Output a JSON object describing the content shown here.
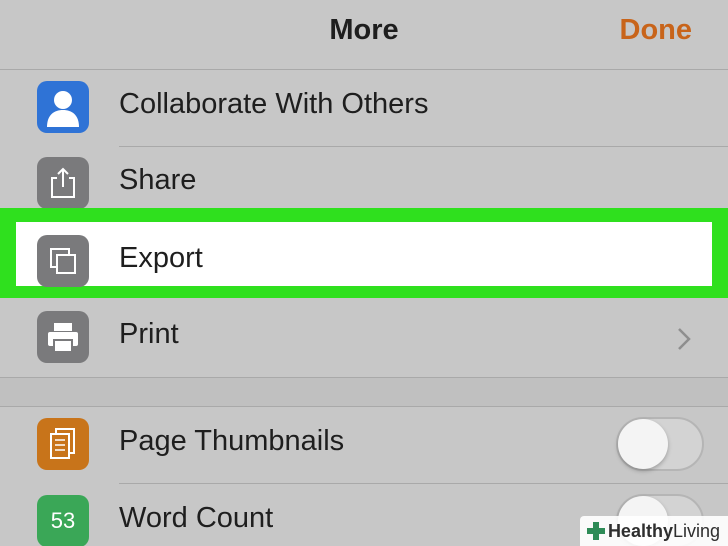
{
  "header": {
    "title": "More",
    "done_label": "Done"
  },
  "menu": [
    {
      "label": "Collaborate With Others",
      "icon": "person-icon",
      "icon_color": "#2f73d6"
    },
    {
      "label": "Share",
      "icon": "share-icon",
      "icon_color": "#7a7a7c"
    },
    {
      "label": "Export",
      "icon": "export-icon",
      "icon_color": "#7a7a7c",
      "highlighted": true
    },
    {
      "label": "Print",
      "icon": "printer-icon",
      "icon_color": "#7a7a7c",
      "has_chevron": true
    }
  ],
  "settings": [
    {
      "label": "Page Thumbnails",
      "icon": "pages-icon",
      "icon_color": "#c8741a",
      "toggle_on": false
    },
    {
      "label": "Word Count",
      "icon_text": "53",
      "icon_color": "#3aa757",
      "toggle_on": false
    }
  ],
  "colors": {
    "highlight": "#2fe01e",
    "accent": "#c8641a",
    "background": "#c7c7c7"
  },
  "watermark": {
    "brand_bold": "Healthy",
    "brand_regular": "Living"
  }
}
